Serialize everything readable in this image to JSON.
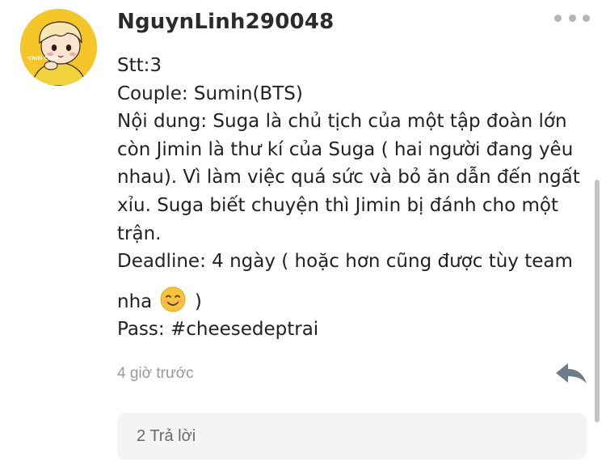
{
  "post": {
    "username": "NguynLinh290048",
    "avatar": {
      "badge_text": "CHIM CHIM"
    },
    "lines": {
      "stt": "Stt:3",
      "couple": "Couple: Sumin(BTS)",
      "content_1": "Nội dung: Suga là chủ tịch của một tập đoàn lớn",
      "content_2": "còn Jimin là thư kí của Suga ( hai người đang yêu",
      "content_3": "nhau). Vì làm việc quá sức và bỏ ăn dẫn đến ngất",
      "content_4": "xỉu. Suga biết chuyện thì Jimin bị đánh cho một",
      "content_5": "trận.",
      "deadline_1": "Deadline: 4 ngày ( hoặc hơn cũng được tùy team",
      "deadline_2a": "nha",
      "deadline_2b": ")",
      "pass": "Pass: #cheesedeptrai"
    },
    "timestamp": "4 giờ trước",
    "replies_label": "2 Trả lời"
  },
  "icons": {
    "more": "more-dots-icon",
    "reply": "reply-arrow-icon",
    "emoji": "smiling-face-emoji"
  },
  "colors": {
    "avatar_bg": "#f4c62a",
    "text": "#222222",
    "muted": "#999999",
    "reply_icon": "#6e7b88",
    "replies_bg": "#f4f4f4"
  }
}
